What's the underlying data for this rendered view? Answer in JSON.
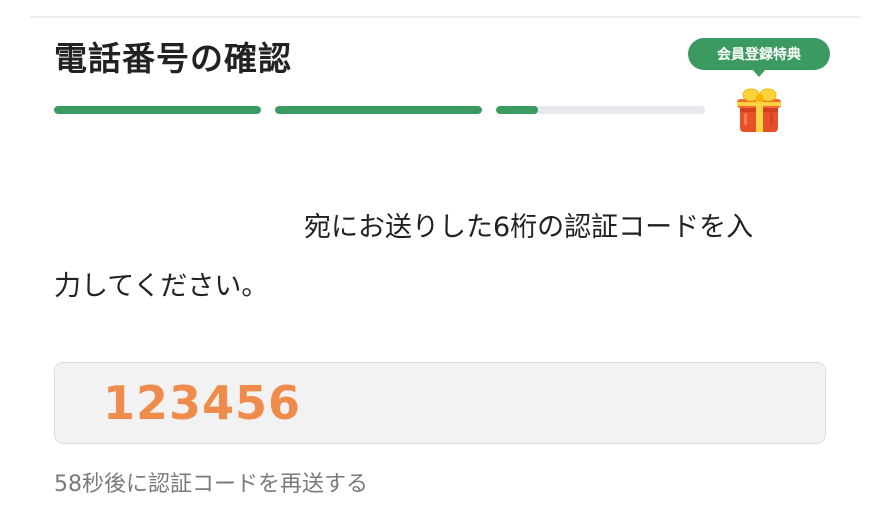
{
  "title": "電話番号の確認",
  "badge": {
    "label": "会員登録特典",
    "icon": "gift-icon"
  },
  "progress": {
    "steps": [
      1,
      1,
      0.2
    ],
    "colors": {
      "fill": "#3a9a5f",
      "track": "#e7e9ef"
    }
  },
  "instruction": {
    "line1": "宛にお送りした6桁の認証コードを入",
    "line2": "力してください。"
  },
  "code_input": {
    "value": "123456"
  },
  "resend": {
    "label": "58秒後に認証コードを再送する"
  },
  "colors": {
    "accent_green": "#3a9a5f",
    "code_orange": "#ef8b4b",
    "text": "#222222",
    "muted_text": "#7a7a7a"
  }
}
